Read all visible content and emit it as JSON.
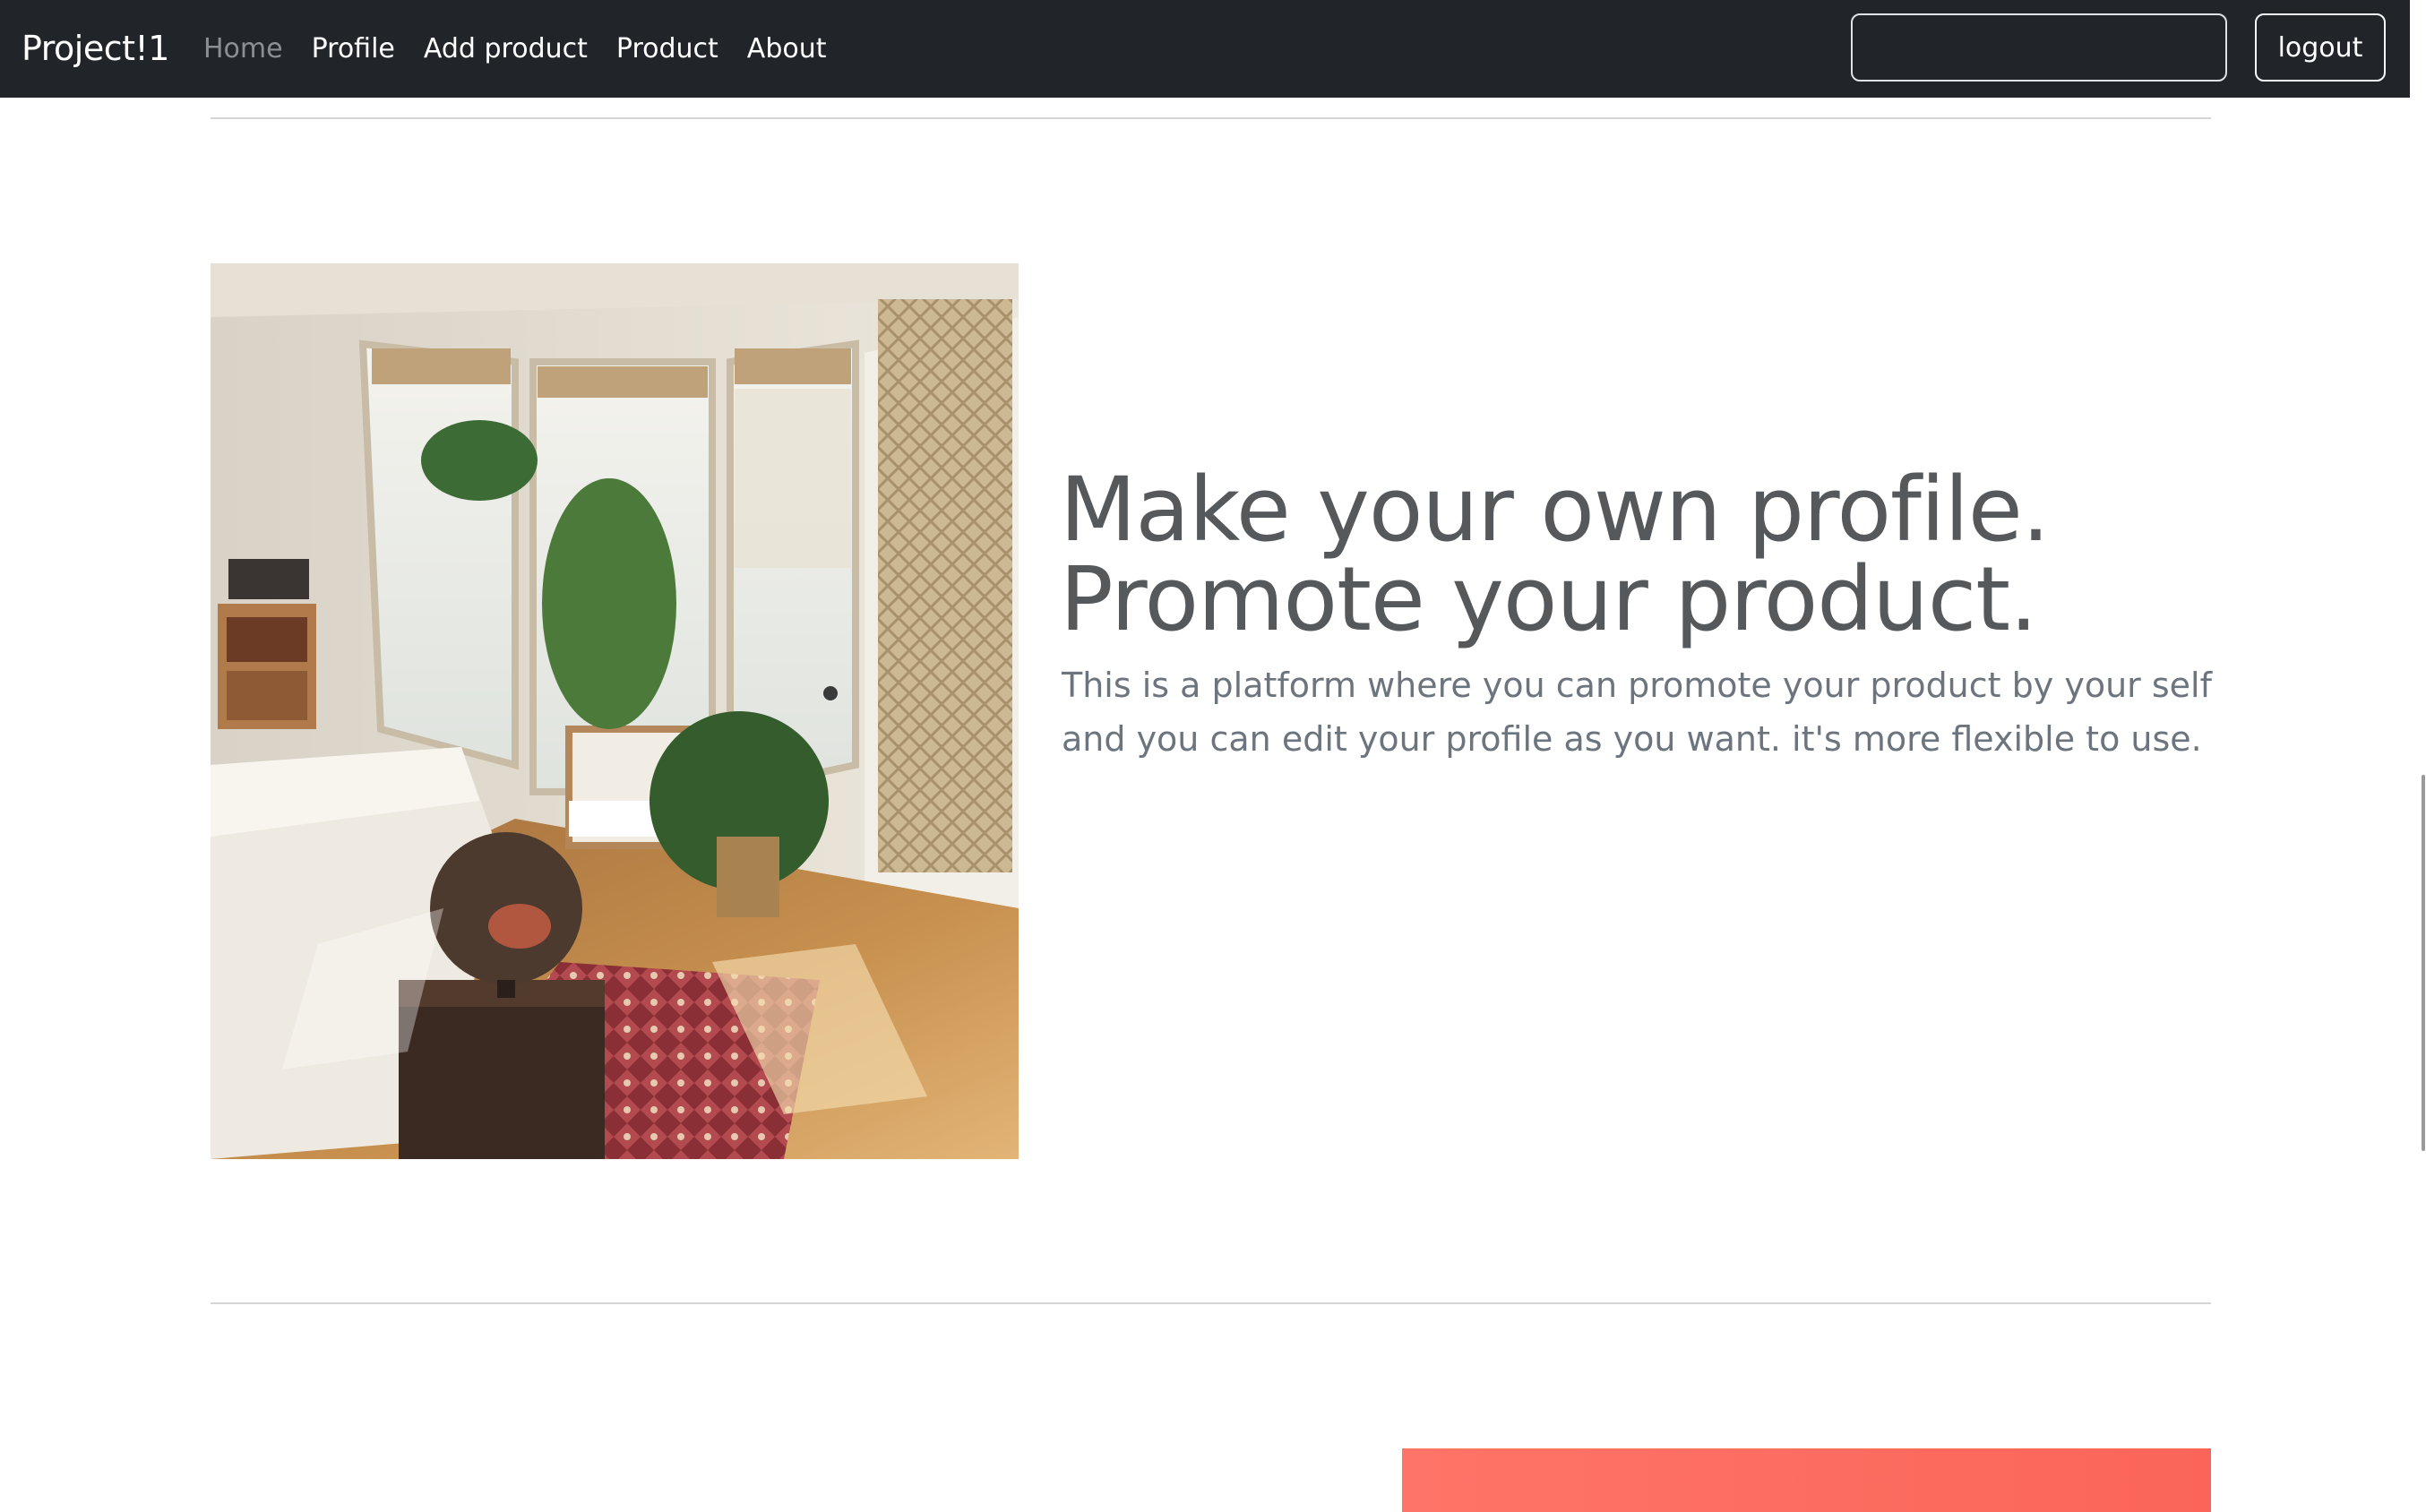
{
  "navbar": {
    "brand": "Project!1",
    "links": [
      {
        "label": "Home",
        "active": true
      },
      {
        "label": "Profile",
        "active": false
      },
      {
        "label": "Add product",
        "active": false
      },
      {
        "label": "Product",
        "active": false
      },
      {
        "label": "About",
        "active": false
      }
    ],
    "search": {
      "value": "",
      "placeholder": ""
    },
    "logout_label": "logout"
  },
  "feature": {
    "image": {
      "icon": "bedroom-photo"
    },
    "heading_line1": "Make your own profile.",
    "heading_line2": "Promote your product.",
    "lead": "This is a platform where you can promote your product by your self and you can edit your profile as you want. it's more flexible to use."
  },
  "colors": {
    "navbar_bg": "#212529",
    "heading": "#55595c",
    "lead_text": "#6c757d",
    "coral_accent": "#ff7468"
  }
}
